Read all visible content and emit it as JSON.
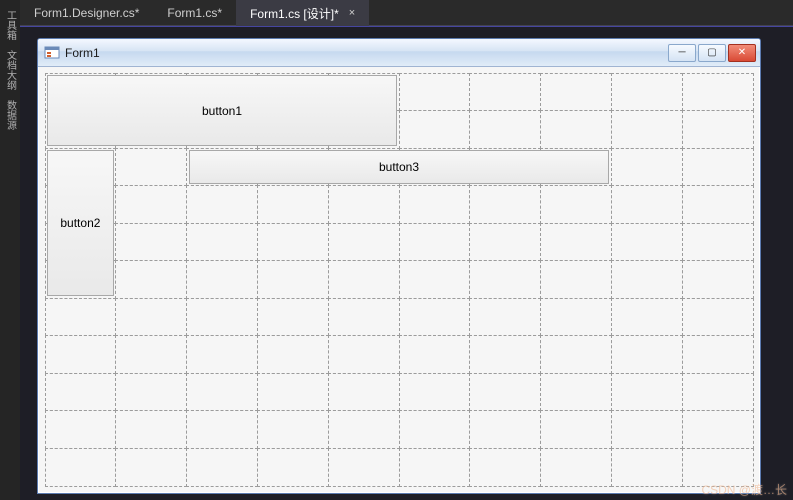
{
  "tool_strip": {
    "tabs": [
      "工具箱",
      "文档大纲",
      "数据源"
    ]
  },
  "tabs": {
    "items": [
      {
        "label": "Form1.Designer.cs*"
      },
      {
        "label": "Form1.cs*"
      },
      {
        "label": "Form1.cs [设计]*"
      }
    ],
    "close_glyph": "×"
  },
  "form": {
    "title": "Form1",
    "buttons": {
      "b1": "button1",
      "b2": "button2",
      "b3": "button3"
    },
    "window_controls": {
      "min": "─",
      "max": "▢",
      "close": "✕"
    }
  },
  "watermark": "CSDN @渡…长"
}
